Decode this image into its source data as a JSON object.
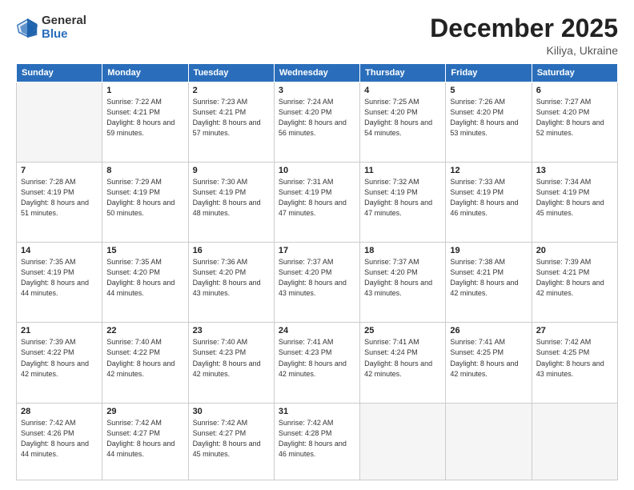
{
  "header": {
    "logo_general": "General",
    "logo_blue": "Blue",
    "title": "December 2025",
    "location": "Kiliya, Ukraine"
  },
  "days_of_week": [
    "Sunday",
    "Monday",
    "Tuesday",
    "Wednesday",
    "Thursday",
    "Friday",
    "Saturday"
  ],
  "weeks": [
    [
      {
        "day": "",
        "sunrise": "",
        "sunset": "",
        "daylight": ""
      },
      {
        "day": "1",
        "sunrise": "Sunrise: 7:22 AM",
        "sunset": "Sunset: 4:21 PM",
        "daylight": "Daylight: 8 hours and 59 minutes."
      },
      {
        "day": "2",
        "sunrise": "Sunrise: 7:23 AM",
        "sunset": "Sunset: 4:21 PM",
        "daylight": "Daylight: 8 hours and 57 minutes."
      },
      {
        "day": "3",
        "sunrise": "Sunrise: 7:24 AM",
        "sunset": "Sunset: 4:20 PM",
        "daylight": "Daylight: 8 hours and 56 minutes."
      },
      {
        "day": "4",
        "sunrise": "Sunrise: 7:25 AM",
        "sunset": "Sunset: 4:20 PM",
        "daylight": "Daylight: 8 hours and 54 minutes."
      },
      {
        "day": "5",
        "sunrise": "Sunrise: 7:26 AM",
        "sunset": "Sunset: 4:20 PM",
        "daylight": "Daylight: 8 hours and 53 minutes."
      },
      {
        "day": "6",
        "sunrise": "Sunrise: 7:27 AM",
        "sunset": "Sunset: 4:20 PM",
        "daylight": "Daylight: 8 hours and 52 minutes."
      }
    ],
    [
      {
        "day": "7",
        "sunrise": "Sunrise: 7:28 AM",
        "sunset": "Sunset: 4:19 PM",
        "daylight": "Daylight: 8 hours and 51 minutes."
      },
      {
        "day": "8",
        "sunrise": "Sunrise: 7:29 AM",
        "sunset": "Sunset: 4:19 PM",
        "daylight": "Daylight: 8 hours and 50 minutes."
      },
      {
        "day": "9",
        "sunrise": "Sunrise: 7:30 AM",
        "sunset": "Sunset: 4:19 PM",
        "daylight": "Daylight: 8 hours and 48 minutes."
      },
      {
        "day": "10",
        "sunrise": "Sunrise: 7:31 AM",
        "sunset": "Sunset: 4:19 PM",
        "daylight": "Daylight: 8 hours and 47 minutes."
      },
      {
        "day": "11",
        "sunrise": "Sunrise: 7:32 AM",
        "sunset": "Sunset: 4:19 PM",
        "daylight": "Daylight: 8 hours and 47 minutes."
      },
      {
        "day": "12",
        "sunrise": "Sunrise: 7:33 AM",
        "sunset": "Sunset: 4:19 PM",
        "daylight": "Daylight: 8 hours and 46 minutes."
      },
      {
        "day": "13",
        "sunrise": "Sunrise: 7:34 AM",
        "sunset": "Sunset: 4:19 PM",
        "daylight": "Daylight: 8 hours and 45 minutes."
      }
    ],
    [
      {
        "day": "14",
        "sunrise": "Sunrise: 7:35 AM",
        "sunset": "Sunset: 4:19 PM",
        "daylight": "Daylight: 8 hours and 44 minutes."
      },
      {
        "day": "15",
        "sunrise": "Sunrise: 7:35 AM",
        "sunset": "Sunset: 4:20 PM",
        "daylight": "Daylight: 8 hours and 44 minutes."
      },
      {
        "day": "16",
        "sunrise": "Sunrise: 7:36 AM",
        "sunset": "Sunset: 4:20 PM",
        "daylight": "Daylight: 8 hours and 43 minutes."
      },
      {
        "day": "17",
        "sunrise": "Sunrise: 7:37 AM",
        "sunset": "Sunset: 4:20 PM",
        "daylight": "Daylight: 8 hours and 43 minutes."
      },
      {
        "day": "18",
        "sunrise": "Sunrise: 7:37 AM",
        "sunset": "Sunset: 4:20 PM",
        "daylight": "Daylight: 8 hours and 43 minutes."
      },
      {
        "day": "19",
        "sunrise": "Sunrise: 7:38 AM",
        "sunset": "Sunset: 4:21 PM",
        "daylight": "Daylight: 8 hours and 42 minutes."
      },
      {
        "day": "20",
        "sunrise": "Sunrise: 7:39 AM",
        "sunset": "Sunset: 4:21 PM",
        "daylight": "Daylight: 8 hours and 42 minutes."
      }
    ],
    [
      {
        "day": "21",
        "sunrise": "Sunrise: 7:39 AM",
        "sunset": "Sunset: 4:22 PM",
        "daylight": "Daylight: 8 hours and 42 minutes."
      },
      {
        "day": "22",
        "sunrise": "Sunrise: 7:40 AM",
        "sunset": "Sunset: 4:22 PM",
        "daylight": "Daylight: 8 hours and 42 minutes."
      },
      {
        "day": "23",
        "sunrise": "Sunrise: 7:40 AM",
        "sunset": "Sunset: 4:23 PM",
        "daylight": "Daylight: 8 hours and 42 minutes."
      },
      {
        "day": "24",
        "sunrise": "Sunrise: 7:41 AM",
        "sunset": "Sunset: 4:23 PM",
        "daylight": "Daylight: 8 hours and 42 minutes."
      },
      {
        "day": "25",
        "sunrise": "Sunrise: 7:41 AM",
        "sunset": "Sunset: 4:24 PM",
        "daylight": "Daylight: 8 hours and 42 minutes."
      },
      {
        "day": "26",
        "sunrise": "Sunrise: 7:41 AM",
        "sunset": "Sunset: 4:25 PM",
        "daylight": "Daylight: 8 hours and 42 minutes."
      },
      {
        "day": "27",
        "sunrise": "Sunrise: 7:42 AM",
        "sunset": "Sunset: 4:25 PM",
        "daylight": "Daylight: 8 hours and 43 minutes."
      }
    ],
    [
      {
        "day": "28",
        "sunrise": "Sunrise: 7:42 AM",
        "sunset": "Sunset: 4:26 PM",
        "daylight": "Daylight: 8 hours and 44 minutes."
      },
      {
        "day": "29",
        "sunrise": "Sunrise: 7:42 AM",
        "sunset": "Sunset: 4:27 PM",
        "daylight": "Daylight: 8 hours and 44 minutes."
      },
      {
        "day": "30",
        "sunrise": "Sunrise: 7:42 AM",
        "sunset": "Sunset: 4:27 PM",
        "daylight": "Daylight: 8 hours and 45 minutes."
      },
      {
        "day": "31",
        "sunrise": "Sunrise: 7:42 AM",
        "sunset": "Sunset: 4:28 PM",
        "daylight": "Daylight: 8 hours and 46 minutes."
      },
      {
        "day": "",
        "sunrise": "",
        "sunset": "",
        "daylight": ""
      },
      {
        "day": "",
        "sunrise": "",
        "sunset": "",
        "daylight": ""
      },
      {
        "day": "",
        "sunrise": "",
        "sunset": "",
        "daylight": ""
      }
    ]
  ]
}
